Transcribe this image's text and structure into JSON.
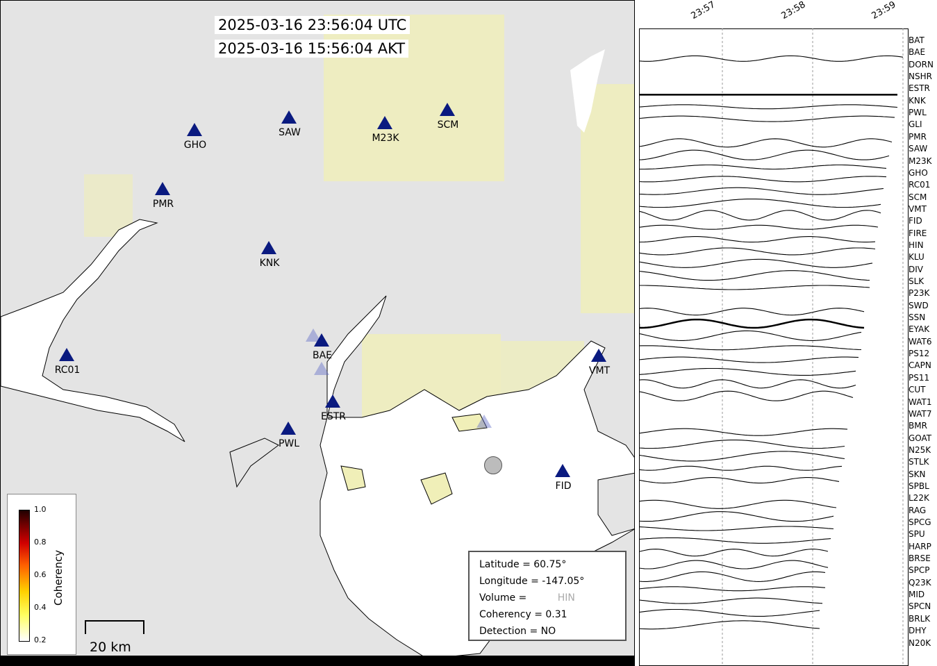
{
  "map": {
    "utc_time": "2025-03-16 23:56:04 UTC",
    "akt_time": "2025-03-16 15:56:04 AKT",
    "stations": [
      {
        "name": "GHO",
        "faded": false
      },
      {
        "name": "SAW",
        "faded": false
      },
      {
        "name": "M23K",
        "faded": false
      },
      {
        "name": "SCM",
        "faded": false
      },
      {
        "name": "PMR",
        "faded": false
      },
      {
        "name": "KNK",
        "faded": false
      },
      {
        "name": "RC01",
        "faded": false
      },
      {
        "name": "BAE",
        "faded": false
      },
      {
        "name": "VMT",
        "faded": false
      },
      {
        "name": "ESTR",
        "faded": false
      },
      {
        "name": "PWL",
        "faded": false
      },
      {
        "name": "FID",
        "faded": false
      },
      {
        "name": "HIN",
        "faded": true
      }
    ],
    "colorbar": {
      "title": "Coherency",
      "ticks": [
        "1.0",
        "0.8",
        "0.6",
        "0.4",
        "0.2"
      ]
    },
    "scale_label": "20 km",
    "info": {
      "latitude": "Latitude = 60.75°",
      "longitude": "Longitude = -147.05°",
      "volume": "Volume =",
      "coherency": "Coherency = 0.31",
      "detection": "Detection = NO"
    }
  },
  "waveforms": {
    "time_ticks": [
      "23:57",
      "23:58",
      "23:59"
    ],
    "stations": [
      "BAT",
      "BAE",
      "DORN",
      "NSHR",
      "ESTR",
      "KNK",
      "PWL",
      "GLI",
      "PMR",
      "SAW",
      "M23K",
      "GHO",
      "RC01",
      "SCM",
      "VMT",
      "FID",
      "FIRE",
      "HIN",
      "KLU",
      "DIV",
      "SLK",
      "P23K",
      "SWD",
      "SSN",
      "EYAK",
      "WAT6",
      "PS12",
      "CAPN",
      "PS11",
      "CUT",
      "WAT1",
      "WAT7",
      "BMR",
      "GOAT",
      "N25K",
      "STLK",
      "SKN",
      "SPBL",
      "L22K",
      "RAG",
      "SPCG",
      "SPU",
      "HARP",
      "BRSE",
      "SPCP",
      "Q23K",
      "MID",
      "SPCN",
      "BRLK",
      "DHY",
      "N20K"
    ]
  },
  "colors": {
    "station": "#0a1a80",
    "water": "#ffffff",
    "land": "#e4e4e4",
    "coherency_low": "#ffff80"
  }
}
